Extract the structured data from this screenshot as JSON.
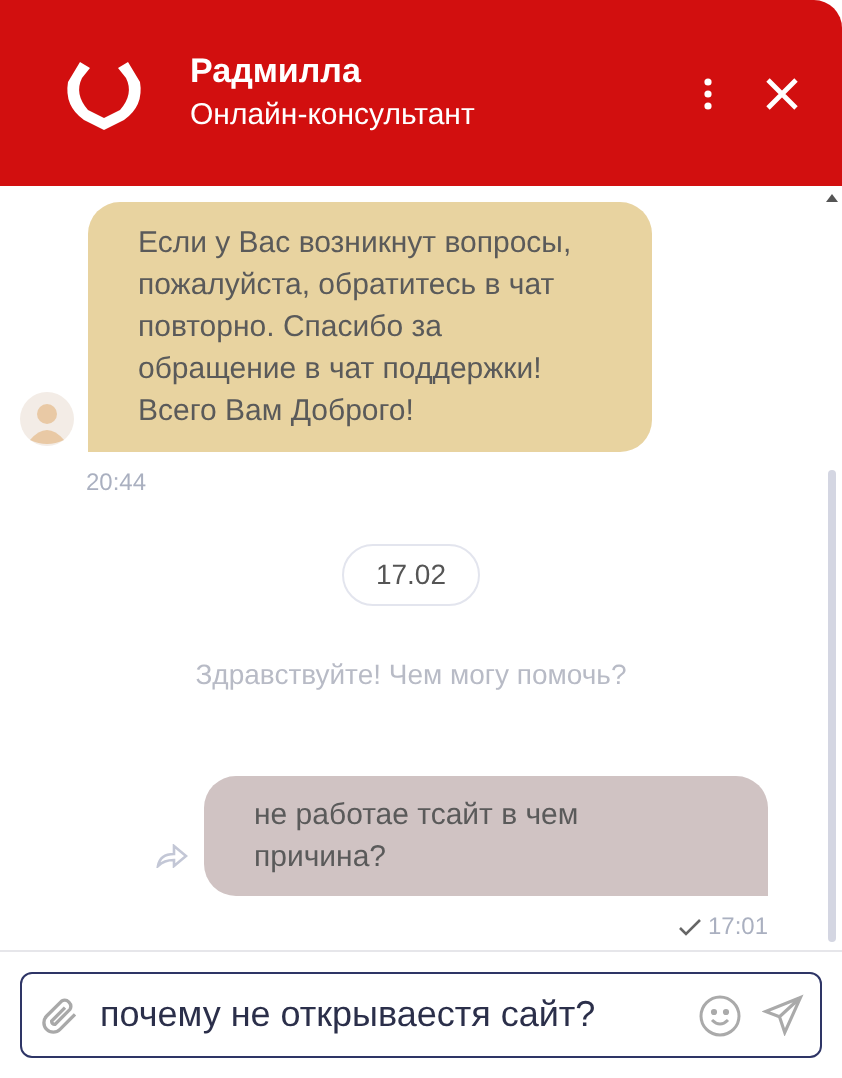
{
  "header": {
    "name": "Радмилла",
    "role": "Онлайн-консультант"
  },
  "messages": [
    {
      "kind": "incoming",
      "text": "Если у Вас возникнут вопросы, пожалуйста, обратитесь в чат повторно. Спасибо за обращение в чат поддержки! Всего Вам Доброго!",
      "time": "20:44"
    },
    {
      "kind": "date",
      "text": "17.02"
    },
    {
      "kind": "system",
      "text": "Здравствуйте! Чем могу помочь?"
    },
    {
      "kind": "outgoing",
      "text": "не работае тсайт в чем причина?",
      "time": "17:01",
      "delivered": true
    }
  ],
  "composer": {
    "value": "почему не открываестя сайт?"
  }
}
